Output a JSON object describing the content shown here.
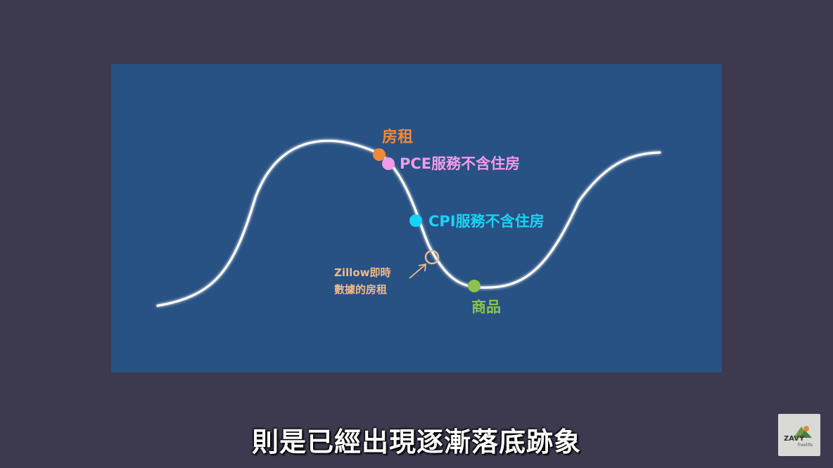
{
  "diagram": {
    "labels": {
      "rent": "房租",
      "pce": "PCE服務不含住房",
      "cpi": "CPI服務不含住房",
      "zillow_line1": "Zillow即時",
      "zillow_line2": "數據的房租",
      "goods": "商品"
    },
    "colors": {
      "background": "#3d3a50",
      "panel": "#285184",
      "curve": "#ffffff",
      "rent": "#f0883a",
      "pce": "#f29be8",
      "cpi": "#17d4f5",
      "zillow": "#f3b98a",
      "goods": "#8ec24f"
    }
  },
  "subtitle": "則是已經出現逐漸落底跡象",
  "logo": {
    "text": "ZAVY",
    "subtext": "freelife",
    "icon": "mountain-icon"
  }
}
